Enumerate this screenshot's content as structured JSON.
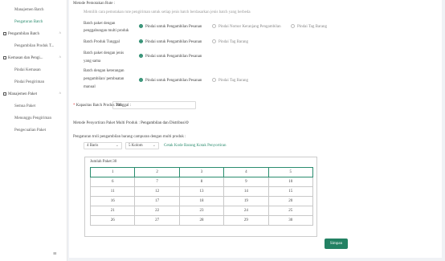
{
  "sidebar": {
    "items": [
      {
        "label": "Manajemen Batch",
        "type": "sub",
        "active": false
      },
      {
        "label": "Pengaturan Batch",
        "type": "sub",
        "active": true
      },
      {
        "label": "Pengambilan Batch",
        "type": "group",
        "chevron": "^"
      },
      {
        "label": "Pengambilan Produk T...",
        "type": "sub",
        "active": false
      },
      {
        "label": "Kemasan dan Pengi...",
        "type": "group",
        "chevron": "^"
      },
      {
        "label": "Pindai Kemasan",
        "type": "sub",
        "active": false
      },
      {
        "label": "Pindai Pengiriman",
        "type": "sub",
        "active": false
      },
      {
        "label": "Manajemen Paket",
        "type": "group",
        "chevron": "^"
      },
      {
        "label": "Semua Paket",
        "type": "sub",
        "active": false
      },
      {
        "label": "Menunggu Pengiriman",
        "type": "sub",
        "active": false
      },
      {
        "label": "Pengecualian Paket",
        "type": "sub",
        "active": false
      }
    ],
    "menu_icon": "≡"
  },
  "form": {
    "method_label": "Metode Pemotakan Rute :",
    "method_hint": "Memilih cara pemotakan rute pengiriman untuk setiap jenis batch berdasarkan jenis batch yang berbeda",
    "rows": [
      {
        "label_lines": [
          "Batch paket dengan",
          "penggabungan multi produk"
        ],
        "options": [
          "Pindai untuk Pengambilan Pesanan",
          "Pindai Nomor Keranjang Pengambilan",
          "Pindai Tag Barang"
        ],
        "selected": 0
      },
      {
        "label_lines": [
          "Batch Produk Tunggal"
        ],
        "options": [
          "Pindai untuk Pengambilan Pesanan",
          "Pindai Tag Barang"
        ],
        "selected": 0
      },
      {
        "label_lines": [
          "Batch paket dengan jenis",
          "yang sama"
        ],
        "options": [
          "Pindai untuk Pengambilan Pesanan"
        ],
        "selected": 0
      },
      {
        "label_lines": [
          "Batch dengan keterangan",
          "pengambilan/ pembuatan",
          "manual"
        ],
        "options": [
          "Pindai untuk Pengambilan Pesanan",
          "Pindai Tag Barang"
        ],
        "selected": 0
      }
    ],
    "capacity_required_mark": "*",
    "capacity_label": "Kapasitas Batch Produk Tunggal :",
    "capacity_value": "300",
    "multi_method_label": "Metode Penyortiran Paket Multi Produk :",
    "multi_method_value": "Pengambilan dan Distribusi",
    "multi_method_icon": "⚙",
    "cart_settings_label": "Pengaturan troli pengambilan barang campuran dengan multi produk :",
    "rows_select": "4 Baris",
    "cols_select": "5 Kolom",
    "select_chevron": "⌄",
    "print_link": "Cetak Kode Barang Kotak Penyortiran",
    "grid_title": "Jumlah Paket:30",
    "grid": [
      [
        "1",
        "2",
        "3",
        "4",
        "5"
      ],
      [
        "6",
        "7",
        "8",
        "9",
        "10"
      ],
      [
        "11",
        "12",
        "13",
        "14",
        "15"
      ],
      [
        "16",
        "17",
        "18",
        "19",
        "20"
      ],
      [
        "21",
        "22",
        "23",
        "24",
        "25"
      ],
      [
        "26",
        "27",
        "28",
        "29",
        "30"
      ]
    ],
    "save_label": "Simpan"
  }
}
